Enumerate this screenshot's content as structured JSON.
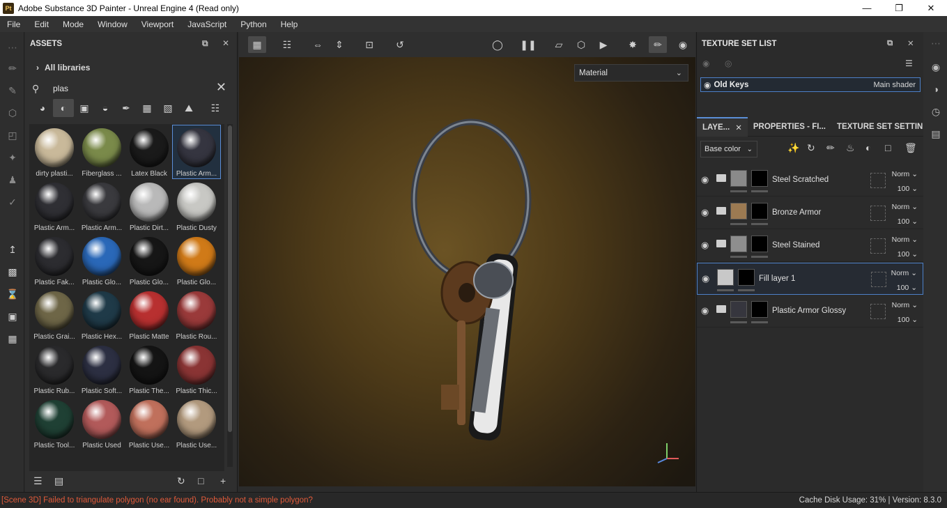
{
  "app": {
    "icon_text": "Pt",
    "title": "Adobe Substance 3D Painter - Unreal Engine 4 (Read only)"
  },
  "menu": [
    "File",
    "Edit",
    "Mode",
    "Window",
    "Viewport",
    "JavaScript",
    "Python",
    "Help"
  ],
  "assets": {
    "title": "ASSETS",
    "breadcrumb": "All libraries",
    "search_value": "plas",
    "items": [
      {
        "label": "dirty plasti...",
        "color": "#c9b99a"
      },
      {
        "label": "Fiberglass ...",
        "color": "#7a8a4a"
      },
      {
        "label": "Latex Black",
        "color": "#1a1a1a"
      },
      {
        "label": "Plastic Arm...",
        "color": "#353540"
      },
      {
        "label": "Plastic Arm...",
        "color": "#2f2f34"
      },
      {
        "label": "Plastic Arm...",
        "color": "#3a3a3e"
      },
      {
        "label": "Plastic Dirt...",
        "color": "#b9b9b9"
      },
      {
        "label": "Plastic Dusty",
        "color": "#c8c8c4"
      },
      {
        "label": "Plastic Fak...",
        "color": "#2c2c30"
      },
      {
        "label": "Plastic Glo...",
        "color": "#2a68b8"
      },
      {
        "label": "Plastic Glo...",
        "color": "#161616"
      },
      {
        "label": "Plastic Glo...",
        "color": "#d07a18"
      },
      {
        "label": "Plastic Grai...",
        "color": "#6e6647"
      },
      {
        "label": "Plastic Hex...",
        "color": "#1f3a48"
      },
      {
        "label": "Plastic Matte",
        "color": "#b83030"
      },
      {
        "label": "Plastic Rou...",
        "color": "#9a3a3a"
      },
      {
        "label": "Plastic Rub...",
        "color": "#2a2a2c"
      },
      {
        "label": "Plastic Soft...",
        "color": "#2c2f42"
      },
      {
        "label": "Plastic The...",
        "color": "#141414"
      },
      {
        "label": "Plastic Thic...",
        "color": "#8a3434"
      },
      {
        "label": "Plastic Tool...",
        "color": "#1f4034"
      },
      {
        "label": "Plastic Used",
        "color": "#b25a5a"
      },
      {
        "label": "Plastic Use...",
        "color": "#c0705c"
      },
      {
        "label": "Plastic Use...",
        "color": "#b29a7e"
      }
    ]
  },
  "viewport": {
    "channel": "Material"
  },
  "texture_set_list": {
    "title": "TEXTURE SET LIST",
    "set_name": "Old Keys",
    "shader": "Main shader"
  },
  "tabs": [
    "LAYE...",
    "PROPERTIES - FI...",
    "TEXTURE SET SETTIN..."
  ],
  "layers": {
    "channel": "Base color",
    "items": [
      {
        "name": "Steel Scratched",
        "blend": "Norm",
        "opacity": "100",
        "thumb": "#8a8a8a",
        "folder": true
      },
      {
        "name": "Bronze Armor",
        "blend": "Norm",
        "opacity": "100",
        "thumb": "#9c7a52",
        "folder": true
      },
      {
        "name": "Steel Stained",
        "blend": "Norm",
        "opacity": "100",
        "thumb": "#8e8e8e",
        "folder": true
      },
      {
        "name": "Fill layer 1",
        "blend": "Norm",
        "opacity": "100",
        "thumb": "#c8c8c8",
        "folder": false
      },
      {
        "name": "Plastic Armor Glossy",
        "blend": "Norm",
        "opacity": "100",
        "thumb": "#36363e",
        "folder": true
      }
    ]
  },
  "status": {
    "error": "[Scene 3D] Failed to triangulate polygon (no ear found). Probably not a simple polygon?",
    "cache": "Cache Disk Usage:    31% | Version: 8.3.0"
  },
  "colors": {
    "accent": "#5b8fd8",
    "error": "#e05a3a"
  }
}
